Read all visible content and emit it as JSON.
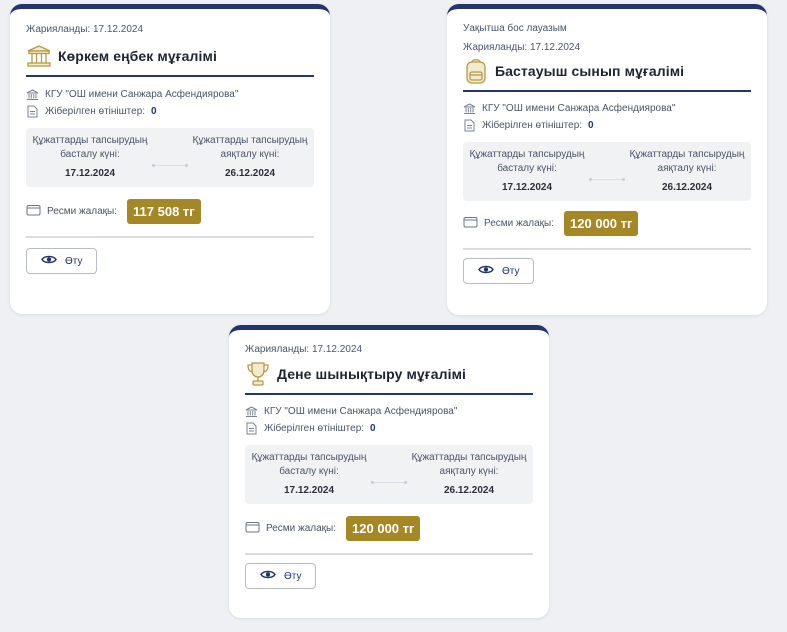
{
  "cards": [
    {
      "badge": "",
      "published": "Жарияланды: 17.12.2024",
      "title": "Көркем еңбек мұғалімі",
      "title_icon": "column-building-icon",
      "org": "КГУ \"ОШ имени Санжара Асфендиярова\"",
      "applications_label": "Жіберілген өтініштер:",
      "applications_count": "0",
      "start_label": "Құжаттарды тапсырудың басталу күні:",
      "start_date": "17.12.2024",
      "end_label": "Құжаттарды тапсырудың аяқталу күні:",
      "end_date": "26.12.2024",
      "salary_label": "Ресми жалақы:",
      "salary": "117 508 тг",
      "view_label": "Өту"
    },
    {
      "badge": "Уақытша бос лауазым",
      "published": "Жарияланды: 17.12.2024",
      "title": "Бастауыш сынып мұғалімі",
      "title_icon": "backpack-icon",
      "org": "КГУ \"ОШ имени Санжара Асфендиярова\"",
      "applications_label": "Жіберілген өтініштер:",
      "applications_count": "0",
      "start_label": "Құжаттарды тапсырудың басталу күні:",
      "start_date": "17.12.2024",
      "end_label": "Құжаттарды тапсырудың аяқталу күні:",
      "end_date": "26.12.2024",
      "salary_label": "Ресми жалақы:",
      "salary": "120 000 тг",
      "view_label": "Өту"
    },
    {
      "badge": "",
      "published": "Жарияланды: 17.12.2024",
      "title": "Дене шынықтыру мұғалімі",
      "title_icon": "trophy-icon",
      "org": "КГУ \"ОШ имени Санжара Асфендиярова\"",
      "applications_label": "Жіберілген өтініштер:",
      "applications_count": "0",
      "start_label": "Құжаттарды тапсырудың басталу күні:",
      "start_date": "17.12.2024",
      "end_label": "Құжаттарды тапсырудың аяқталу күні:",
      "end_date": "26.12.2024",
      "salary_label": "Ресми жалақы:",
      "salary": "120 000 тг",
      "view_label": "Өту"
    }
  ],
  "colors": {
    "accent": "#23346e",
    "salary_badge": "#a68725",
    "background": "#eef0f3"
  }
}
